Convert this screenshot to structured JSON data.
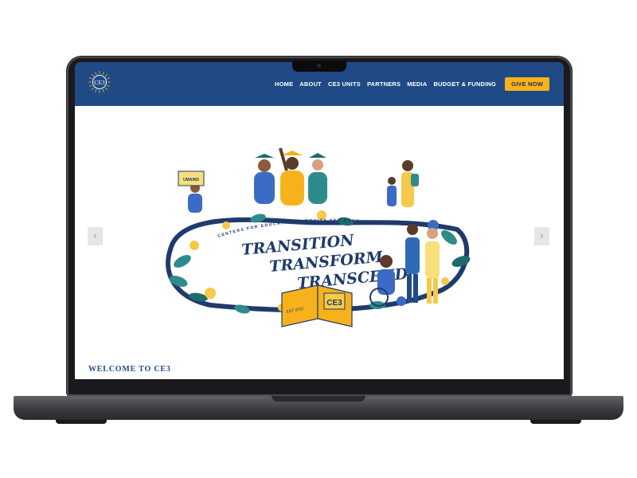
{
  "header": {
    "logo_text": "CE3",
    "nav": [
      {
        "label": "HOME"
      },
      {
        "label": "ABOUT"
      },
      {
        "label": "CE3 UNITS"
      },
      {
        "label": "PARTNERS"
      },
      {
        "label": "MEDIA"
      },
      {
        "label": "BUDGET & FUNDING"
      }
    ],
    "cta_label": "GIVE NOW"
  },
  "hero": {
    "arc_text": "CENTERS FOR EDUCATIONAL EQUITY AND EXCELLENCE",
    "line1": "TRANSITION",
    "line2": "TRANSFORM",
    "line3": "TRANSCEND",
    "book_text": "CE3",
    "est_text": "EST 2012",
    "sign_text": "UMAIND",
    "prev_icon": "chevron-left-icon",
    "next_icon": "chevron-right-icon"
  },
  "welcome_heading": "WELCOME TO CE3",
  "colors": {
    "header_bg": "#1f4a86",
    "accent": "#f7b21b",
    "ink": "#1f3a6b"
  }
}
